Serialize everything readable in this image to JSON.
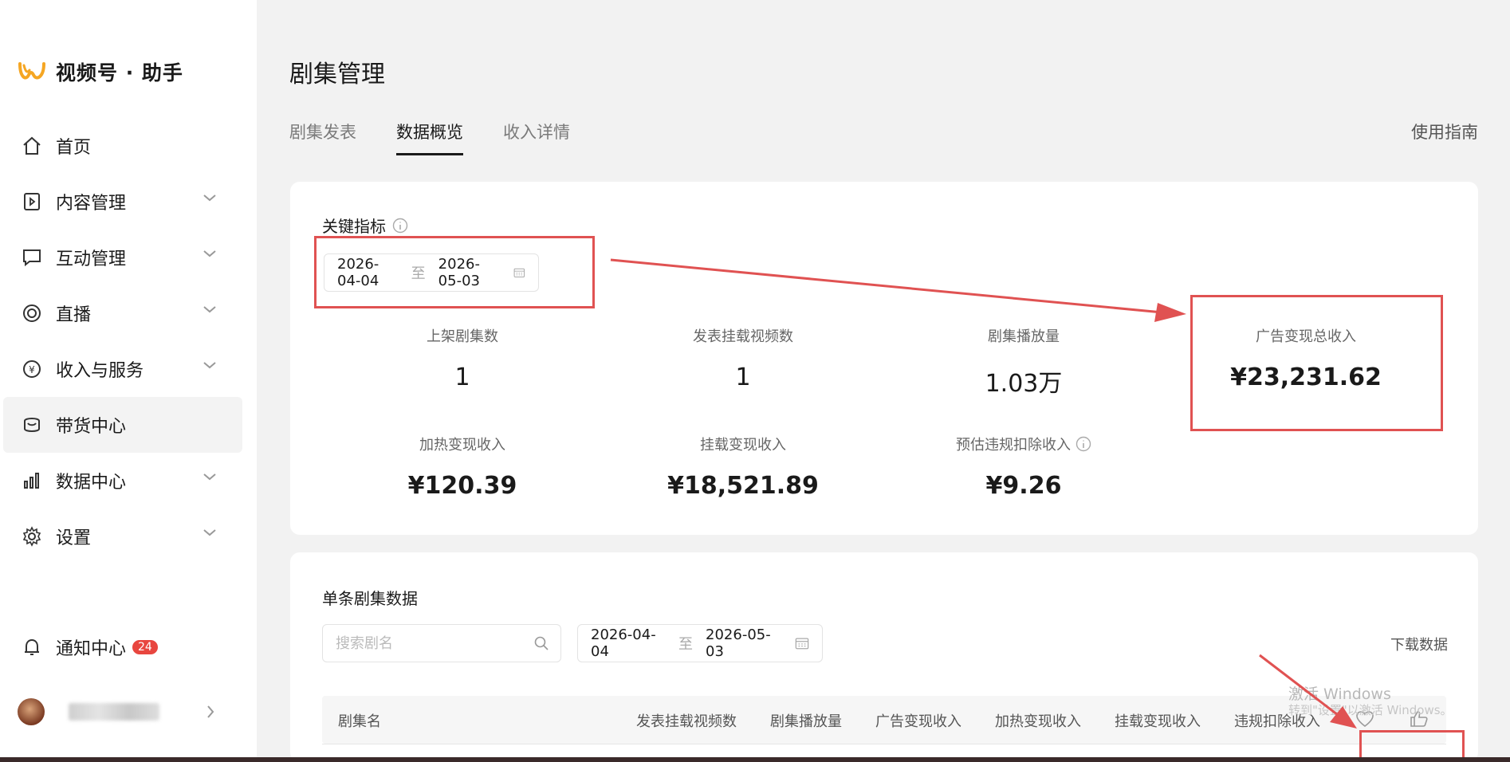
{
  "sidebar": {
    "logo_text": "视频号 · 助手",
    "items": [
      {
        "label": "首页",
        "icon": "home-icon"
      },
      {
        "label": "内容管理",
        "icon": "play-square-icon"
      },
      {
        "label": "互动管理",
        "icon": "chat-icon"
      },
      {
        "label": "直播",
        "icon": "live-icon"
      },
      {
        "label": "收入与服务",
        "icon": "yuan-icon"
      },
      {
        "label": "带货中心",
        "icon": "shop-icon"
      },
      {
        "label": "数据中心",
        "icon": "bar-chart-icon"
      },
      {
        "label": "设置",
        "icon": "gear-icon"
      }
    ],
    "notice_label": "通知中心",
    "notice_count": "24"
  },
  "page": {
    "title": "剧集管理",
    "tabs": [
      "剧集发表",
      "数据概览",
      "收入详情"
    ],
    "guide": "使用指南"
  },
  "key_metrics": {
    "title": "关键指标",
    "date_start": "2026-04-04",
    "date_sep": "至",
    "date_end": "2026-05-03",
    "items": [
      {
        "label": "上架剧集数",
        "value": "1"
      },
      {
        "label": "发表挂载视频数",
        "value": "1"
      },
      {
        "label": "剧集播放量",
        "value": "1.03万"
      },
      {
        "label": "广告变现总收入",
        "value": "¥23,231.62"
      },
      {
        "label": "加热变现收入",
        "value": "¥120.39"
      },
      {
        "label": "挂载变现收入",
        "value": "¥18,521.89"
      },
      {
        "label": "预估违规扣除收入",
        "value": "¥9.26"
      }
    ]
  },
  "single_data": {
    "title": "单条剧集数据",
    "search_placeholder": "搜索剧名",
    "date_start": "2026-04-04",
    "date_sep": "至",
    "date_end": "2026-05-03",
    "download": "下载数据",
    "columns": [
      "剧集名",
      "发表挂载视频数",
      "剧集播放量",
      "广告变现收入",
      "加热变现收入",
      "挂载变现收入",
      "违规扣除收入"
    ]
  },
  "watermark": {
    "line1": "激活 Windows",
    "line2": "转到\"设置\"以激活 Windows。"
  },
  "colors": {
    "annotation": "#e05252",
    "badge": "#e8463f",
    "logo": "#f5a623"
  }
}
